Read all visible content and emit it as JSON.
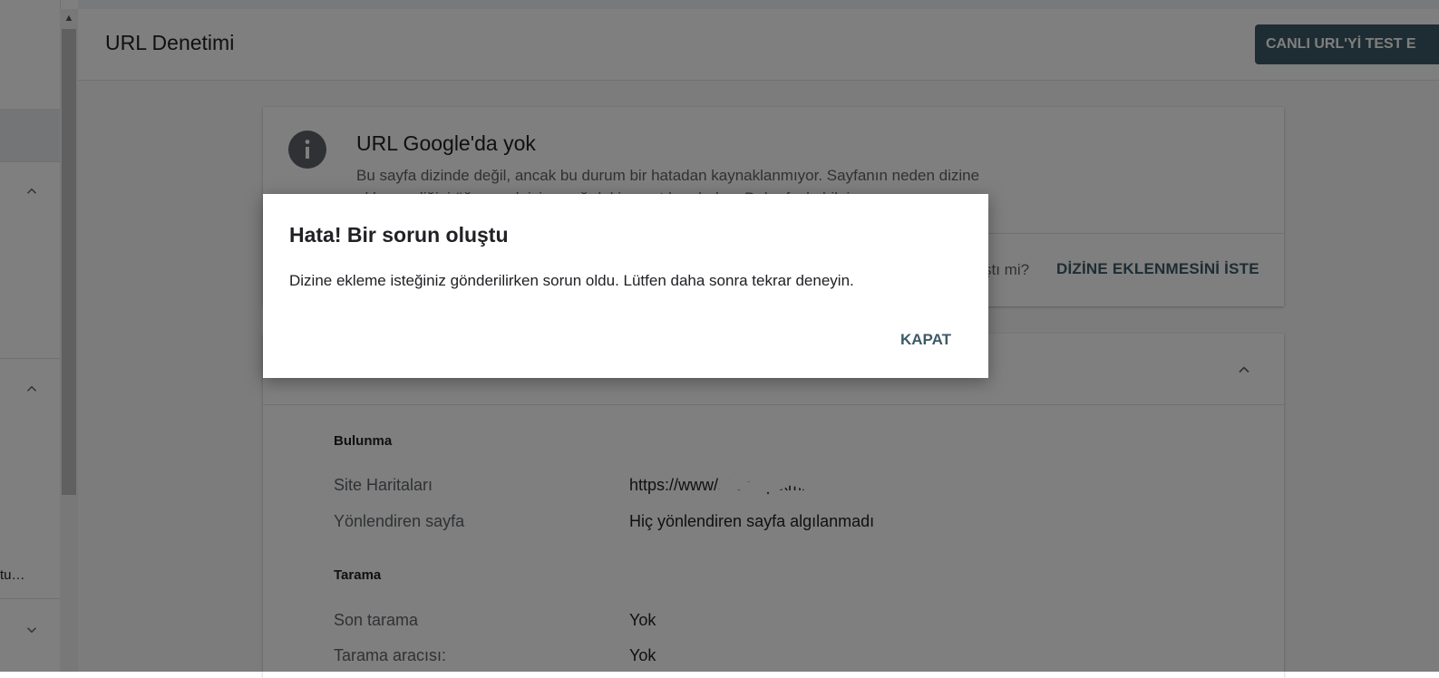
{
  "header": {
    "title": "URL Denetimi",
    "test_live_button": "CANLI URL'Yİ TEST E"
  },
  "sidebar": {
    "truncated_item": "tu…"
  },
  "status_card": {
    "icon": "info-icon",
    "title": "URL Google'da yok",
    "description": "Bu sayfa dizinde değil, ancak bu durum bir hatadan kaynaklanmıyor. Sayfanın neden dizine eklenmediğini öğrenmek için aşağıdaki ayrıntılara bakın. Daha fazla bilgi",
    "request_question": "ştı mi?",
    "request_button": "DİZİNE EKLENMESİNİ İSTE"
  },
  "details": {
    "discovery": {
      "heading": "Bulunma",
      "rows": [
        {
          "label": "Site Haritaları",
          "value": "https://www/sitemap.xml"
        },
        {
          "label": "Yönlendiren sayfa",
          "value": "Hiç yönlendiren sayfa algılanmadı"
        }
      ]
    },
    "crawl": {
      "heading": "Tarama",
      "rows": [
        {
          "label": "Son tarama",
          "value": "Yok"
        },
        {
          "label": "Tarama aracısı:",
          "value": "Yok"
        }
      ]
    }
  },
  "dialog": {
    "title": "Hata! Bir sorun oluştu",
    "message": "Dizine ekleme isteğiniz gönderilirken sorun oldu. Lütfen daha sonra tekrar deneyin.",
    "close_button": "KAPAT"
  },
  "colors": {
    "accent": "#3c5a66",
    "overlay": "rgba(0,0,0,0.5)",
    "muted_text": "#5f6368"
  }
}
